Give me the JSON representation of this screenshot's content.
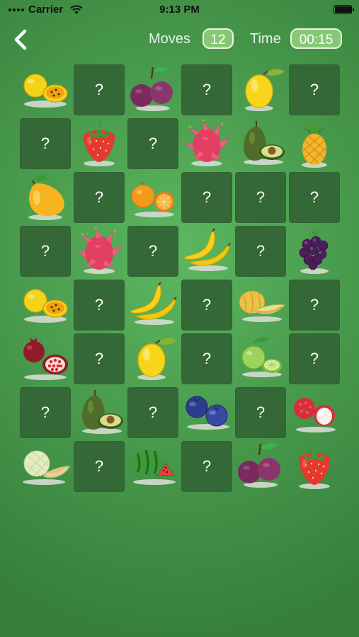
{
  "status": {
    "carrier": "Carrier",
    "time": "9:13 PM",
    "battery_level": 1.0
  },
  "header": {
    "moves_label": "Moves",
    "moves_value": "12",
    "time_label": "Time",
    "time_value": "00:15"
  },
  "colors": {
    "hidden_tile": "#346837",
    "pill_bg": "#87c877",
    "pill_border": "#e8f5e0"
  },
  "board": {
    "columns": 6,
    "rows": [
      [
        {
          "state": "revealed",
          "fruit": "passion-fruit"
        },
        {
          "state": "hidden",
          "label": "?"
        },
        {
          "state": "revealed",
          "fruit": "plum"
        },
        {
          "state": "hidden",
          "label": "?"
        },
        {
          "state": "revealed",
          "fruit": "lemon"
        },
        {
          "state": "hidden",
          "label": "?"
        }
      ],
      [
        {
          "state": "hidden",
          "label": "?"
        },
        {
          "state": "revealed",
          "fruit": "strawberry"
        },
        {
          "state": "hidden",
          "label": "?"
        },
        {
          "state": "revealed",
          "fruit": "dragon-fruit"
        },
        {
          "state": "revealed",
          "fruit": "avocado"
        },
        {
          "state": "revealed",
          "fruit": "pineapple"
        }
      ],
      [
        {
          "state": "revealed",
          "fruit": "mango"
        },
        {
          "state": "hidden",
          "label": "?"
        },
        {
          "state": "revealed",
          "fruit": "orange"
        },
        {
          "state": "hidden",
          "label": "?"
        },
        {
          "state": "hidden",
          "label": "?"
        },
        {
          "state": "hidden",
          "label": "?"
        }
      ],
      [
        {
          "state": "hidden",
          "label": "?"
        },
        {
          "state": "revealed",
          "fruit": "dragon-fruit"
        },
        {
          "state": "hidden",
          "label": "?"
        },
        {
          "state": "revealed",
          "fruit": "banana"
        },
        {
          "state": "hidden",
          "label": "?"
        },
        {
          "state": "revealed",
          "fruit": "blackberry"
        }
      ],
      [
        {
          "state": "revealed",
          "fruit": "passion-fruit"
        },
        {
          "state": "hidden",
          "label": "?"
        },
        {
          "state": "revealed",
          "fruit": "banana"
        },
        {
          "state": "hidden",
          "label": "?"
        },
        {
          "state": "revealed",
          "fruit": "cantaloupe"
        },
        {
          "state": "hidden",
          "label": "?"
        }
      ],
      [
        {
          "state": "revealed",
          "fruit": "pomegranate"
        },
        {
          "state": "hidden",
          "label": "?"
        },
        {
          "state": "revealed",
          "fruit": "lemon"
        },
        {
          "state": "hidden",
          "label": "?"
        },
        {
          "state": "revealed",
          "fruit": "lime"
        },
        {
          "state": "hidden",
          "label": "?"
        }
      ],
      [
        {
          "state": "hidden",
          "label": "?"
        },
        {
          "state": "revealed",
          "fruit": "avocado"
        },
        {
          "state": "hidden",
          "label": "?"
        },
        {
          "state": "revealed",
          "fruit": "blueberry"
        },
        {
          "state": "hidden",
          "label": "?"
        },
        {
          "state": "revealed",
          "fruit": "lychee"
        }
      ],
      [
        {
          "state": "revealed",
          "fruit": "honeydew"
        },
        {
          "state": "hidden",
          "label": "?"
        },
        {
          "state": "revealed",
          "fruit": "watermelon"
        },
        {
          "state": "hidden",
          "label": "?"
        },
        {
          "state": "revealed",
          "fruit": "plum"
        },
        {
          "state": "revealed",
          "fruit": "strawberry"
        }
      ]
    ]
  }
}
